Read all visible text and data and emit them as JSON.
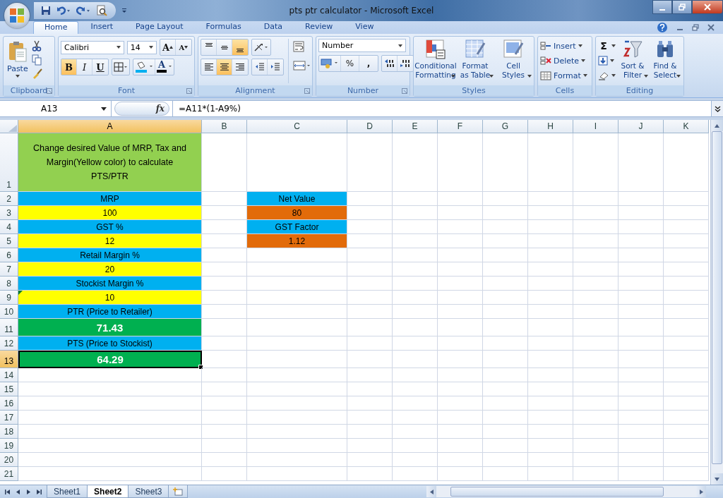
{
  "window": {
    "title": "pts ptr calculator - Microsoft Excel"
  },
  "ribbon_tabs": [
    {
      "label": "Home",
      "selected": true
    },
    {
      "label": "Insert",
      "selected": false
    },
    {
      "label": "Page Layout",
      "selected": false
    },
    {
      "label": "Formulas",
      "selected": false
    },
    {
      "label": "Data",
      "selected": false
    },
    {
      "label": "Review",
      "selected": false
    },
    {
      "label": "View",
      "selected": false
    }
  ],
  "clipboard": {
    "paste": "Paste",
    "group": "Clipboard"
  },
  "font": {
    "name": "Calibri",
    "size": "14",
    "grow": "A",
    "shrink": "A",
    "group": "Font",
    "styles": [
      {
        "kind": "bold",
        "label": "B",
        "on": true
      },
      {
        "kind": "italic",
        "label": "I",
        "on": false
      },
      {
        "kind": "underline",
        "label": "U",
        "on": false
      }
    ],
    "color_label": "A"
  },
  "alignment": {
    "group": "Alignment",
    "vertical": [
      {
        "kind": "top",
        "on": false
      },
      {
        "kind": "middle",
        "on": false
      },
      {
        "kind": "bottom",
        "on": true
      }
    ],
    "horizontal": [
      {
        "kind": "left",
        "on": false
      },
      {
        "kind": "center",
        "on": true
      },
      {
        "kind": "right",
        "on": false
      }
    ]
  },
  "number": {
    "group": "Number",
    "format": "Number",
    "percent": "%",
    "comma": ","
  },
  "styles": {
    "group": "Styles",
    "buttons": [
      {
        "kind": "conditional",
        "label": "Conditional Formatting"
      },
      {
        "kind": "table",
        "label": "Format as Table"
      },
      {
        "kind": "cell",
        "label": "Cell Styles"
      }
    ]
  },
  "cells": {
    "group": "Cells",
    "buttons": [
      {
        "kind": "insert",
        "label": "Insert"
      },
      {
        "kind": "delete",
        "label": "Delete"
      },
      {
        "kind": "format",
        "label": "Format"
      }
    ]
  },
  "editing": {
    "group": "Editing",
    "sum": "Σ",
    "buttons": [
      {
        "kind": "sort",
        "label": "Sort & Filter"
      },
      {
        "kind": "find",
        "label": "Find & Select"
      }
    ]
  },
  "formula_bar": {
    "name_box": "A13",
    "fx": "fx",
    "formula": "=A11*(1-A9%)"
  },
  "columns": [
    {
      "label": "A",
      "selected": true
    },
    {
      "label": "B",
      "selected": false
    },
    {
      "label": "C",
      "selected": false
    },
    {
      "label": "D",
      "selected": false
    },
    {
      "label": "E",
      "selected": false
    },
    {
      "label": "F",
      "selected": false
    },
    {
      "label": "G",
      "selected": false
    },
    {
      "label": "H",
      "selected": false
    },
    {
      "label": "I",
      "selected": false
    },
    {
      "label": "J",
      "selected": false
    },
    {
      "label": "K",
      "selected": false
    }
  ],
  "rows": [
    {
      "header": "1",
      "kind": "tall",
      "selected": false,
      "a": {
        "text": "Change desired Value of MRP, Tax and Margin(Yellow color) to calculate PTS/PTR",
        "color": "#92d050"
      }
    },
    {
      "header": "2",
      "kind": "normal",
      "selected": false,
      "a": {
        "text": "MRP",
        "color": "#00b0f0"
      },
      "c": {
        "text": "Net Value",
        "color": "#00b0f0"
      }
    },
    {
      "header": "3",
      "kind": "normal",
      "selected": false,
      "a": {
        "text": "100",
        "color": "#ffff00"
      },
      "c": {
        "text": "80",
        "color": "#e26b0a"
      }
    },
    {
      "header": "4",
      "kind": "normal",
      "selected": false,
      "a": {
        "text": "GST %",
        "color": "#00b0f0"
      },
      "c": {
        "text": "GST Factor",
        "color": "#00b0f0"
      }
    },
    {
      "header": "5",
      "kind": "normal",
      "selected": false,
      "a": {
        "text": "12",
        "color": "#ffff00"
      },
      "c": {
        "text": "1.12",
        "color": "#e26b0a"
      }
    },
    {
      "header": "6",
      "kind": "normal",
      "selected": false,
      "a": {
        "text": "Retail Margin %",
        "color": "#00b0f0"
      }
    },
    {
      "header": "7",
      "kind": "normal",
      "selected": false,
      "a": {
        "text": "20",
        "color": "#ffff00"
      }
    },
    {
      "header": "8",
      "kind": "normal",
      "selected": false,
      "a": {
        "text": "Stockist Margin %",
        "color": "#00b0f0"
      }
    },
    {
      "header": "9",
      "kind": "normal",
      "selected": false,
      "a": {
        "text": "10",
        "color": "#ffff00",
        "error_indicator": true
      }
    },
    {
      "header": "10",
      "kind": "normal",
      "selected": false,
      "a": {
        "text": "PTR (Price to Retailer)",
        "color": "#00b0f0"
      }
    },
    {
      "header": "11",
      "kind": "result",
      "selected": false,
      "a": {
        "text": "71.43",
        "color": "#00b050"
      }
    },
    {
      "header": "12",
      "kind": "normal",
      "selected": false,
      "a": {
        "text": "PTS (Price to Stockist)",
        "color": "#00b0f0"
      }
    },
    {
      "header": "13",
      "kind": "result",
      "selected": true,
      "a": {
        "text": "64.29",
        "color": "#00b050"
      }
    },
    {
      "header": "14",
      "kind": "normal",
      "selected": false
    },
    {
      "header": "15",
      "kind": "normal",
      "selected": false
    },
    {
      "header": "16",
      "kind": "normal",
      "selected": false
    },
    {
      "header": "17",
      "kind": "normal",
      "selected": false
    },
    {
      "header": "18",
      "kind": "normal",
      "selected": false
    },
    {
      "header": "19",
      "kind": "normal",
      "selected": false
    },
    {
      "header": "20",
      "kind": "normal",
      "selected": false
    },
    {
      "header": "21",
      "kind": "normal",
      "selected": false
    }
  ],
  "sheets": [
    {
      "label": "Sheet1",
      "selected": false
    },
    {
      "label": "Sheet2",
      "selected": true
    },
    {
      "label": "Sheet3",
      "selected": false
    }
  ]
}
